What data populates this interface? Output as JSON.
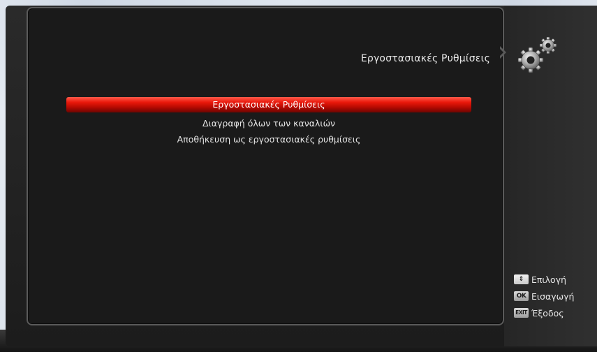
{
  "screen": {
    "title": "Εργοστασιακές Ρυθμίσεις",
    "icon": "gears-icon"
  },
  "menu": {
    "selected_index": 0,
    "items": [
      {
        "label": "Εργοστασιακές Ρυθμίσεις"
      },
      {
        "label": "Διαγραφή όλων των καναλιών"
      },
      {
        "label": "Αποθήκευση ως εργοστασιακές ρυθμίσεις"
      }
    ]
  },
  "legend": {
    "items": [
      {
        "key": "⇕",
        "key_icon": "up-down-key-icon",
        "label": "Επιλογή"
      },
      {
        "key": "OK",
        "key_icon": "ok-key-icon",
        "label": "Εισαγωγή"
      },
      {
        "key": "EXIT",
        "key_icon": "exit-key-icon",
        "label": "Έξοδος"
      }
    ]
  },
  "colors": {
    "highlight": "#e8170a",
    "text": "#e6e6e6",
    "panel_border": "#5a5a5a",
    "panel_bg": "#1a1a1a"
  }
}
